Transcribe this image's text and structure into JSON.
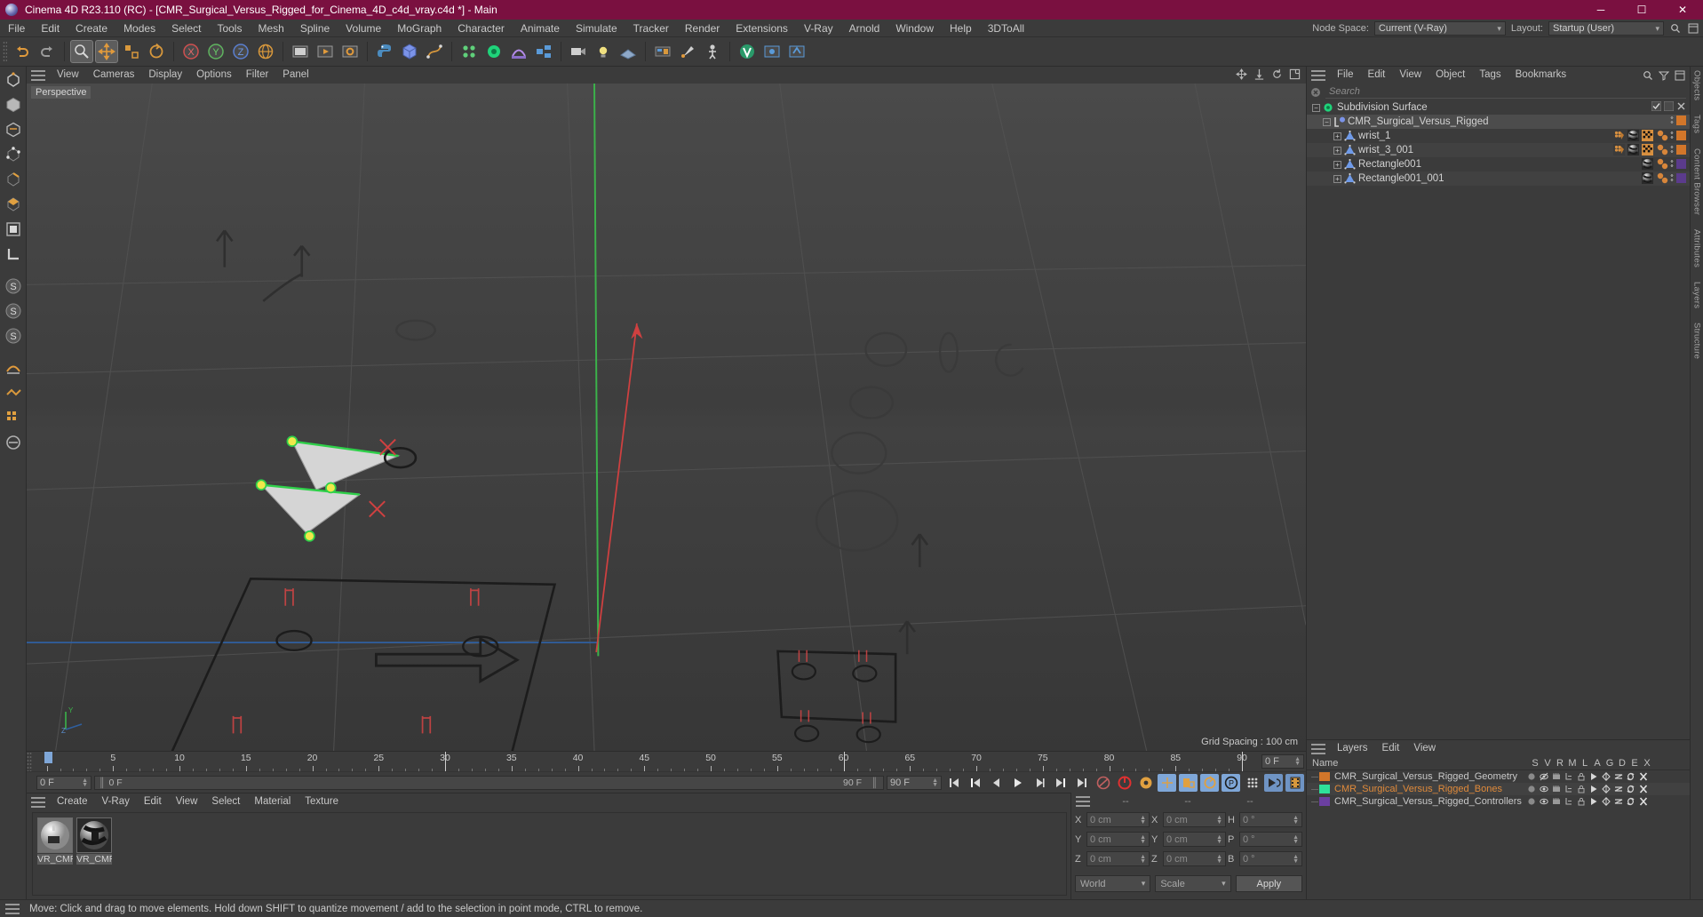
{
  "window": {
    "title": "Cinema 4D R23.110 (RC) - [CMR_Surgical_Versus_Rigged_for_Cinema_4D_c4d_vray.c4d *] - Main",
    "minimize": "─",
    "maximize": "☐",
    "close": "✕"
  },
  "menubar": {
    "items": [
      "File",
      "Edit",
      "Create",
      "Modes",
      "Select",
      "Tools",
      "Mesh",
      "Spline",
      "Volume",
      "MoGraph",
      "Character",
      "Animate",
      "Simulate",
      "Tracker",
      "Render",
      "Extensions",
      "V-Ray",
      "Arnold",
      "Window",
      "Help",
      "3DToAll"
    ],
    "node_space_label": "Node Space:",
    "node_space_value": "Current (V-Ray)",
    "layout_label": "Layout:",
    "layout_value": "Startup (User)",
    "search_icon": "search-icon",
    "panel_icon": "panel-icon"
  },
  "viewport": {
    "menu": [
      "View",
      "Cameras",
      "Display",
      "Options",
      "Filter",
      "Panel"
    ],
    "label": "Perspective",
    "grid_spacing": "Grid Spacing : 100 cm",
    "axis_y": "Y",
    "axis_z": "Z"
  },
  "timeline": {
    "ticks": [
      0,
      5,
      10,
      15,
      20,
      25,
      30,
      35,
      40,
      45,
      50,
      55,
      60,
      65,
      70,
      75,
      80,
      85,
      90
    ],
    "current_frame": "0 F",
    "current_frame_2": "0 F",
    "end_frame": "90 F",
    "end_frame_2": "90 F",
    "preview_end": "90 F",
    "right_frame": "0 F"
  },
  "material_manager": {
    "menu": [
      "Create",
      "V-Ray",
      "Edit",
      "View",
      "Select",
      "Material",
      "Texture"
    ],
    "materials": [
      {
        "name": "VR_CMR"
      },
      {
        "name": "VR_CMR"
      }
    ]
  },
  "coordinates": {
    "header": [
      "--",
      "--",
      "--"
    ],
    "rows": [
      {
        "l1": "X",
        "v1": "0 cm",
        "l2": "X",
        "v2": "0 cm",
        "l3": "H",
        "v3": "0 °"
      },
      {
        "l1": "Y",
        "v1": "0 cm",
        "l2": "Y",
        "v2": "0 cm",
        "l3": "P",
        "v3": "0 °"
      },
      {
        "l1": "Z",
        "v1": "0 cm",
        "l2": "Z",
        "v2": "0 cm",
        "l3": "B",
        "v3": "0 °"
      }
    ],
    "world": "World",
    "scale": "Scale",
    "apply": "Apply"
  },
  "object_manager": {
    "menu": [
      "File",
      "Edit",
      "View",
      "Object",
      "Tags",
      "Bookmarks"
    ],
    "search_placeholder": "Search",
    "items": [
      {
        "name": "Subdivision Surface",
        "indent": 0,
        "icon": "subdivision-surface-icon",
        "color": "#1fd37a",
        "tags": [],
        "swatch": null,
        "selected": false,
        "checkbox": true
      },
      {
        "name": "CMR_Surgical_Versus_Rigged",
        "indent": 1,
        "icon": "null-object-icon",
        "color": "#7b93e8",
        "tags": [],
        "swatch": "#d2762a",
        "selected": true,
        "checkbox": false
      },
      {
        "name": "wrist_1",
        "indent": 2,
        "icon": "polygon-object-icon",
        "color": "#6f9ae8",
        "tags": [
          "weight-tag",
          "material-tag",
          "texture-tag",
          "joint-tag"
        ],
        "swatch": "#d2762a",
        "selected": false,
        "checkbox": false
      },
      {
        "name": "wrist_3_001",
        "indent": 2,
        "icon": "polygon-object-icon",
        "color": "#6f9ae8",
        "tags": [
          "weight-tag",
          "material-tag",
          "texture-tag",
          "joint-tag"
        ],
        "swatch": "#d2762a",
        "selected": false,
        "checkbox": false
      },
      {
        "name": "Rectangle001",
        "indent": 2,
        "icon": "polygon-object-icon",
        "color": "#6f9ae8",
        "tags": [
          "material-tag",
          "joint-tag"
        ],
        "swatch": "#5b3b8c",
        "selected": false,
        "checkbox": false
      },
      {
        "name": "Rectangle001_001",
        "indent": 2,
        "icon": "polygon-object-icon",
        "color": "#6f9ae8",
        "tags": [
          "material-tag",
          "joint-tag"
        ],
        "swatch": "#5b3b8c",
        "selected": false,
        "checkbox": false
      }
    ]
  },
  "layers_manager": {
    "menu": [
      "Layers",
      "Edit",
      "View"
    ],
    "columns": [
      "Name",
      "S",
      "V",
      "R",
      "M",
      "L",
      "A",
      "G",
      "D",
      "E",
      "X"
    ],
    "rows": [
      {
        "name": "CMR_Surgical_Versus_Rigged_Geometry",
        "color": "#d2762a",
        "text_color": "#c9c9c9",
        "visible": false
      },
      {
        "name": "CMR_Surgical_Versus_Rigged_Bones",
        "color": "#2fe09a",
        "text_color": "#e08a3a",
        "visible": true
      },
      {
        "name": "CMR_Surgical_Versus_Rigged_Controllers",
        "color": "#6b3fa0",
        "text_color": "#c9c9c9",
        "visible": true
      }
    ]
  },
  "right_tabs": [
    "Objects",
    "Tags",
    "Content Browser",
    "Attributes",
    "Layers",
    "Structure"
  ],
  "statusbar": {
    "text": "Move: Click and drag to move elements. Hold down SHIFT to quantize movement / add to the selection in point mode, CTRL to remove."
  },
  "toolbar": {
    "items": [
      {
        "name": "undo-button",
        "icon": "undo"
      },
      {
        "name": "redo-button",
        "icon": "redo"
      },
      {
        "name": "select-live-button",
        "icon": "cursor",
        "selected": true
      },
      {
        "name": "move-button",
        "icon": "move",
        "selected": true
      },
      {
        "name": "scale-button",
        "icon": "scale"
      },
      {
        "name": "rotate-button",
        "icon": "rotate"
      },
      {
        "name": "world-object-button",
        "icon": "globe"
      },
      {
        "name": "lock-x-button",
        "icon": "x-axis"
      },
      {
        "name": "lock-y-button",
        "icon": "y-axis"
      },
      {
        "name": "lock-z-button",
        "icon": "z-axis"
      },
      {
        "name": "world-coord-button",
        "icon": "world"
      },
      {
        "name": "render-view-button",
        "icon": "render-view"
      },
      {
        "name": "render-to-pv-button",
        "icon": "render-pv"
      },
      {
        "name": "render-settings-button",
        "icon": "render-settings"
      },
      {
        "name": "python-button",
        "icon": "python"
      },
      {
        "name": "cube-button",
        "icon": "cube"
      },
      {
        "name": "spline-pen-button",
        "icon": "pen"
      },
      {
        "name": "mograph-button",
        "icon": "mograph"
      },
      {
        "name": "subdivision-button",
        "icon": "subdivision"
      },
      {
        "name": "deformer-button",
        "icon": "deformer"
      },
      {
        "name": "scene-nodes-button",
        "icon": "scene-nodes"
      },
      {
        "name": "camera-button",
        "icon": "camera"
      },
      {
        "name": "light-button",
        "icon": "light"
      },
      {
        "name": "floor-button",
        "icon": "floor"
      },
      {
        "name": "texture-button",
        "icon": "texture"
      },
      {
        "name": "paint-button",
        "icon": "paint"
      },
      {
        "name": "character-button",
        "icon": "character"
      },
      {
        "name": "vray-button",
        "icon": "vray"
      },
      {
        "name": "vray-extra-button",
        "icon": "vray2"
      },
      {
        "name": "vray-extra2-button",
        "icon": "vray3"
      }
    ]
  }
}
